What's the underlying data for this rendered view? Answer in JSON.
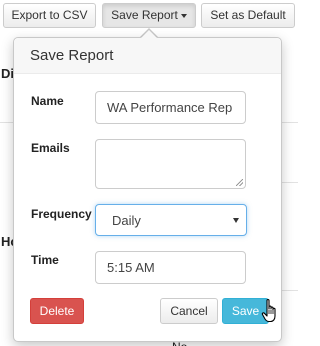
{
  "toolbar": {
    "export_csv_label": "Export to CSV",
    "save_report_label": "Save Report",
    "set_default_label": "Set as Default"
  },
  "background": {
    "left_text_1": "Di",
    "left_text_2": "Ho",
    "bottom_text": "No"
  },
  "save_report_popover": {
    "title": "Save Report",
    "name_label": "Name",
    "name_value": "WA Performance Rep",
    "emails_label": "Emails",
    "emails_value": "",
    "frequency_label": "Frequency",
    "frequency_selected": "Daily",
    "time_label": "Time",
    "time_value": "5:15 AM",
    "delete_label": "Delete",
    "cancel_label": "Cancel",
    "save_label": "Save"
  },
  "colors": {
    "danger": "#d9534f",
    "primary": "#46b8da",
    "focus_border": "#66afe9"
  },
  "icons": {
    "caret": "caret-down-icon",
    "select_caret": "select-caret-icon",
    "cursor": "hand-pointer-cursor-icon"
  }
}
